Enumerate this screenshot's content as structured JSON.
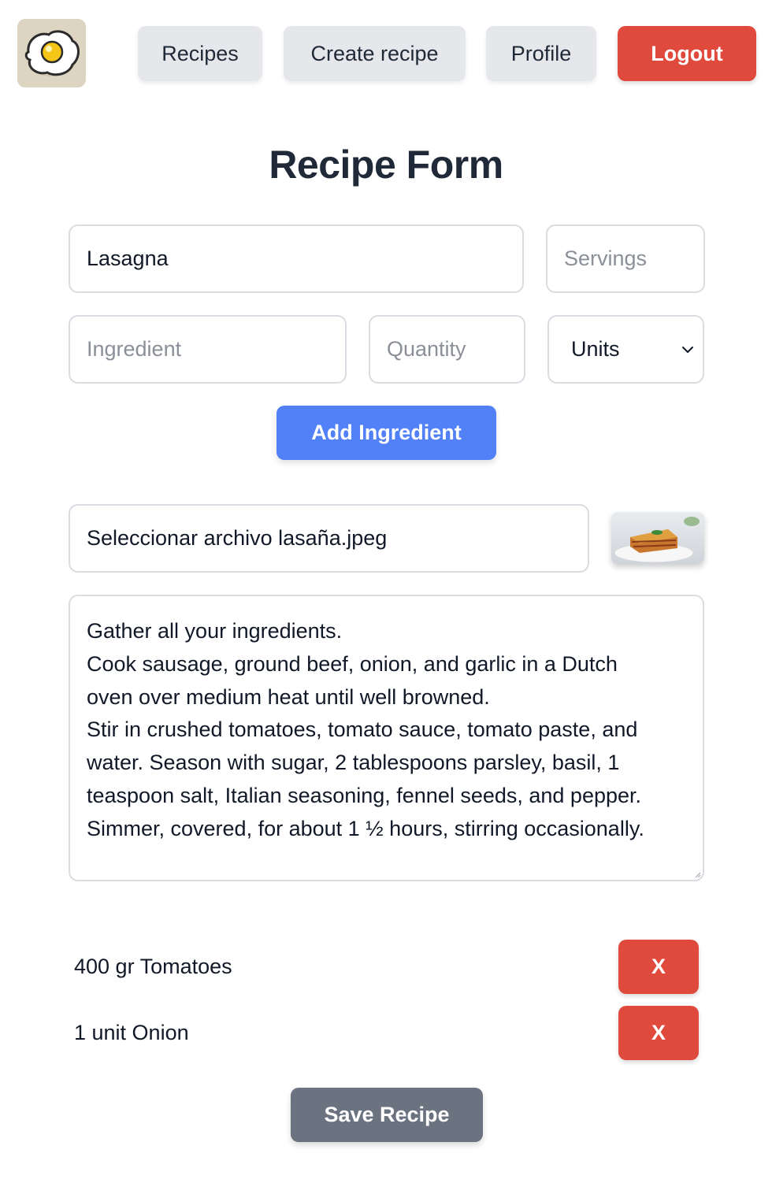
{
  "nav": {
    "logo_icon": "fried-egg-icon",
    "items": [
      {
        "label": "Recipes"
      },
      {
        "label": "Create recipe"
      },
      {
        "label": "Profile"
      },
      {
        "label": "Logout"
      }
    ]
  },
  "form": {
    "title": "Recipe Form",
    "name": {
      "value": "Lasagna",
      "placeholder": ""
    },
    "servings": {
      "value": "",
      "placeholder": "Servings"
    },
    "ingredient": {
      "value": "",
      "placeholder": "Ingredient"
    },
    "quantity": {
      "value": "",
      "placeholder": "Quantity"
    },
    "units": {
      "selected": "Units"
    },
    "add_ingredient_label": "Add Ingredient",
    "file": {
      "button_label": "Seleccionar archivo",
      "filename": "lasaña.jpeg"
    },
    "image_preview": "lasagna-photo",
    "instructions": [
      "Gather all your ingredients.",
      "Cook sausage, ground beef, onion, and garlic in a Dutch",
      "oven over medium heat until well browned.",
      "Stir in crushed tomatoes, tomato sauce, tomato paste, and",
      "water. Season with sugar, 2 tablespoons parsley, basil, 1",
      "teaspoon salt, Italian seasoning, fennel seeds, and pepper.",
      "Simmer, covered, for about 1 ½ hours, stirring occasionally."
    ]
  },
  "ingredients": [
    {
      "text": "400 gr Tomatoes",
      "remove_label": "X"
    },
    {
      "text": "1 unit Onion",
      "remove_label": "X"
    }
  ],
  "save_label": "Save Recipe",
  "colors": {
    "primary": "#5280f7",
    "danger": "#e04a3c",
    "neutral": "#e5e7eb",
    "save": "#6b7280"
  }
}
